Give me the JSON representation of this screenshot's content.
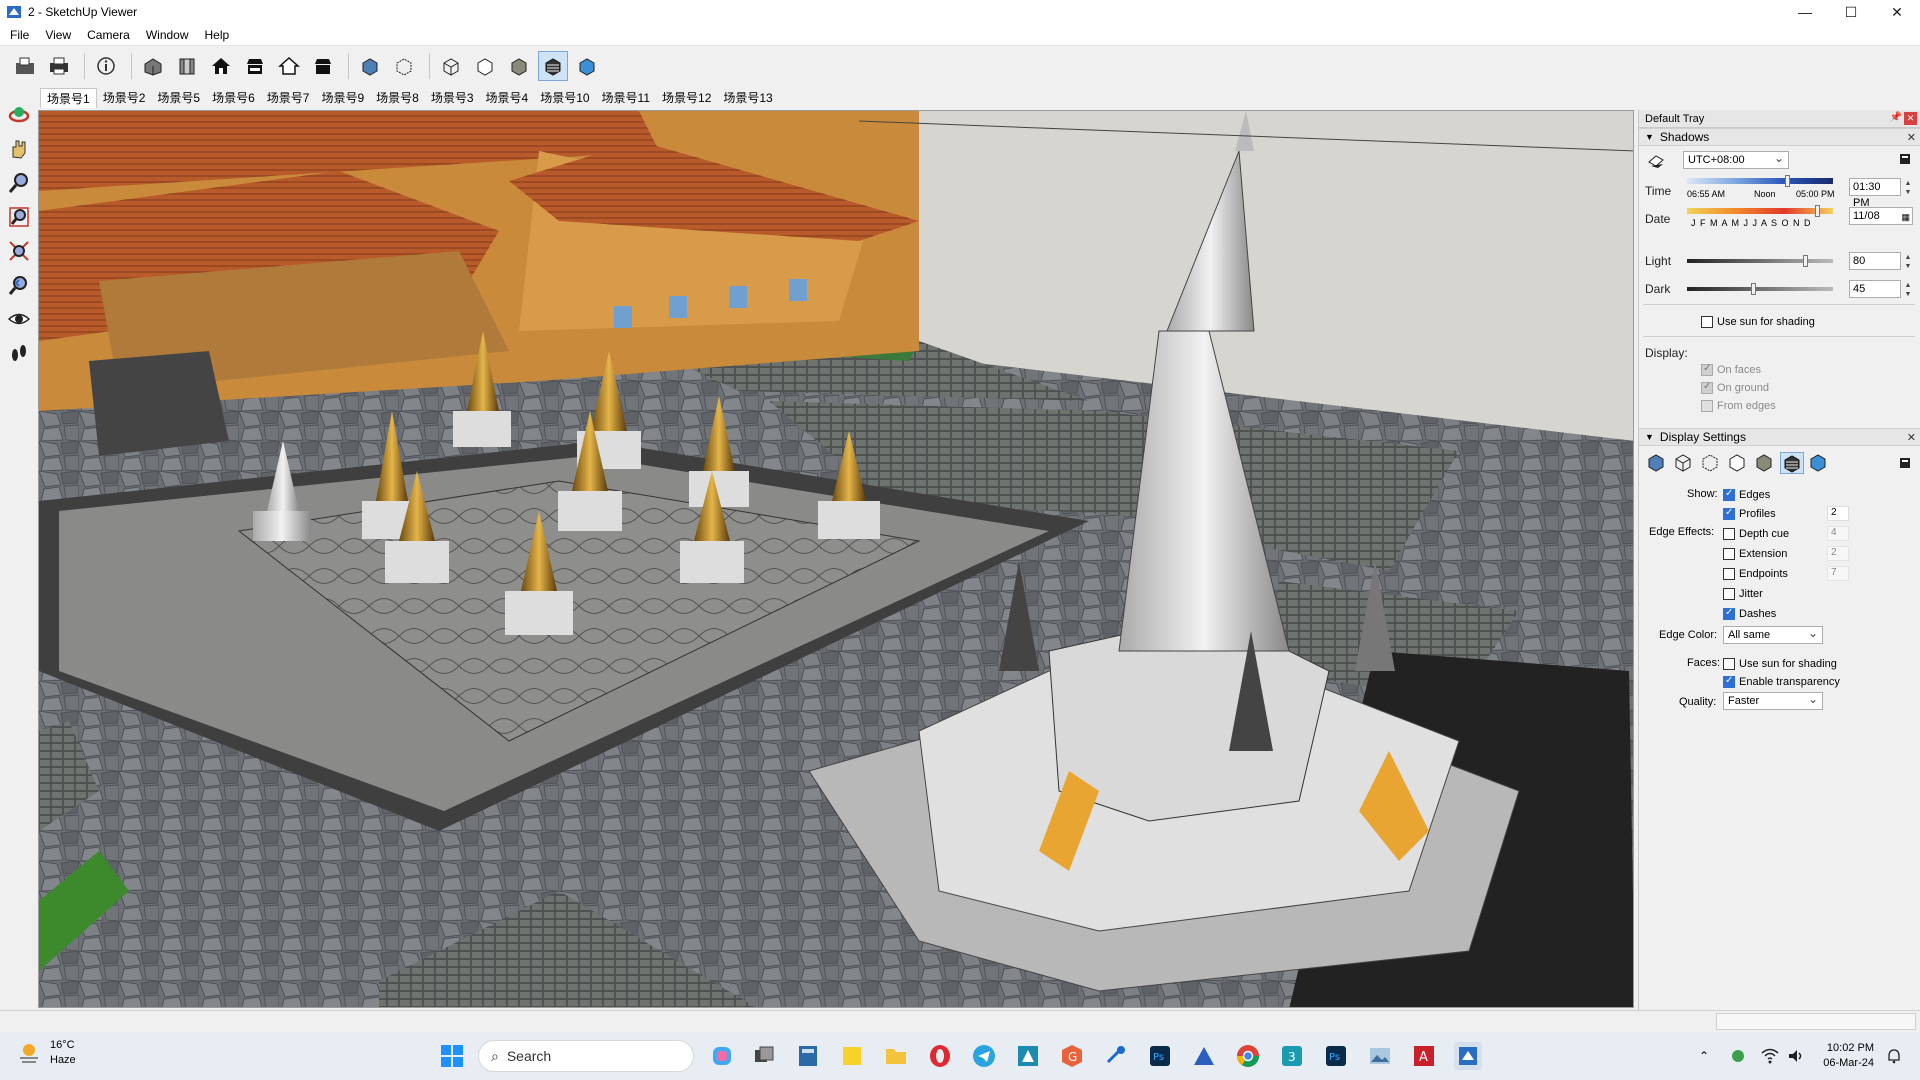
{
  "window": {
    "title": "2 - SketchUp Viewer",
    "controls": {
      "minimize": "—",
      "maximize": "☐",
      "close": "✕"
    }
  },
  "menu": {
    "items": [
      "File",
      "View",
      "Camera",
      "Window",
      "Help"
    ]
  },
  "toolbar": {
    "icons": [
      "open-icon",
      "print-icon",
      "model-info-icon",
      "iso-view-icon",
      "front-view-icon",
      "house-front-icon",
      "house-right-icon",
      "house-back-icon",
      "house-left-icon",
      "xray-icon",
      "back-edges-icon",
      "wireframe-icon",
      "hidden-line-icon",
      "shaded-icon",
      "shaded-textures-icon",
      "monochrome-icon"
    ]
  },
  "scenes": {
    "tabs": [
      "场景号1",
      "场景号2",
      "场景号5",
      "场景号6",
      "场景号7",
      "场景号9",
      "场景号8",
      "场景号3",
      "场景号4",
      "场景号10",
      "场景号11",
      "场景号12",
      "场景号13"
    ],
    "active_index": 0
  },
  "left_tools": [
    "orbit-icon",
    "pan-icon",
    "zoom-icon",
    "zoom-window-icon",
    "zoom-extents-icon",
    "previous-view-icon",
    "look-around-icon",
    "walk-icon"
  ],
  "tray": {
    "title": "Default Tray",
    "shadows": {
      "title": "Shadows",
      "timezone": "UTC+08:00",
      "time_label": "Time",
      "time_sunrise": "06:55 AM",
      "time_noon": "Noon",
      "time_sunset": "05:00 PM",
      "time_value": "01:30 PM",
      "date_label": "Date",
      "months": "J F M A M J J A S O N D",
      "date_value": "11/08",
      "light_label": "Light",
      "light_value": "80",
      "dark_label": "Dark",
      "dark_value": "45",
      "use_sun_label": "Use sun for shading",
      "display_label": "Display:",
      "on_faces": "On faces",
      "on_ground": "On ground",
      "from_edges": "From edges"
    },
    "display_settings": {
      "title": "Display Settings",
      "show_label": "Show:",
      "edges": "Edges",
      "profiles": "Profiles",
      "profiles_value": "2",
      "edge_effects_label": "Edge Effects:",
      "depth_cue": "Depth cue",
      "depth_cue_value": "4",
      "extension": "Extension",
      "extension_value": "2",
      "endpoints": "Endpoints",
      "endpoints_value": "7",
      "jitter": "Jitter",
      "dashes": "Dashes",
      "edge_color_label": "Edge Color:",
      "edge_color_value": "All same",
      "faces_label": "Faces:",
      "faces_use_sun": "Use sun for shading",
      "enable_transparency": "Enable transparency",
      "quality_label": "Quality:",
      "quality_value": "Faster"
    }
  },
  "taskbar": {
    "weather_temp": "16°C",
    "weather_desc": "Haze",
    "search_placeholder": "Search",
    "time": "10:02 PM",
    "date": "06-Mar-24"
  },
  "colors": {
    "accent": "#2d6fd4",
    "roof": "#b85a2a",
    "stone": "#6f7378",
    "plaza": "#8b8d8f"
  }
}
